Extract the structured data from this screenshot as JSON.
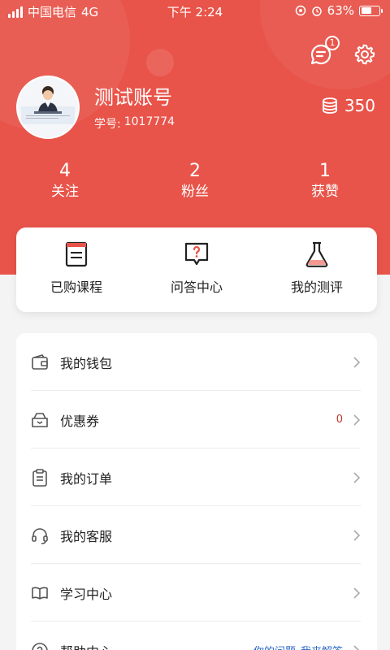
{
  "status_bar": {
    "carrier": "中国电信",
    "network": "4G",
    "time": "下午 2:24",
    "battery": "63%",
    "battery_level": 0.63
  },
  "header": {
    "notification_count": "1"
  },
  "profile": {
    "name": "测试账号",
    "student_id_label": "学号:",
    "student_id": "1017774",
    "coins": "350"
  },
  "stats": [
    {
      "value": "4",
      "label": "关注"
    },
    {
      "value": "2",
      "label": "粉丝"
    },
    {
      "value": "1",
      "label": "获赞"
    }
  ],
  "quick_actions": [
    {
      "label": "已购课程",
      "icon": "book-icon"
    },
    {
      "label": "问答中心",
      "icon": "question-board-icon"
    },
    {
      "label": "我的测评",
      "icon": "flask-icon"
    }
  ],
  "menu": [
    {
      "label": "我的钱包",
      "icon": "wallet-icon"
    },
    {
      "label": "优惠券",
      "icon": "coupon-icon",
      "value": "0"
    },
    {
      "label": "我的订单",
      "icon": "clipboard-icon"
    },
    {
      "label": "我的客服",
      "icon": "headset-icon"
    },
    {
      "label": "学习中心",
      "icon": "open-book-icon"
    },
    {
      "label": "帮助中心",
      "icon": "help-icon",
      "links": [
        "你的问题",
        "我来解答"
      ]
    }
  ],
  "colors": {
    "accent": "#e8544a",
    "link": "#2c6ac7",
    "value": "#c0392b"
  }
}
